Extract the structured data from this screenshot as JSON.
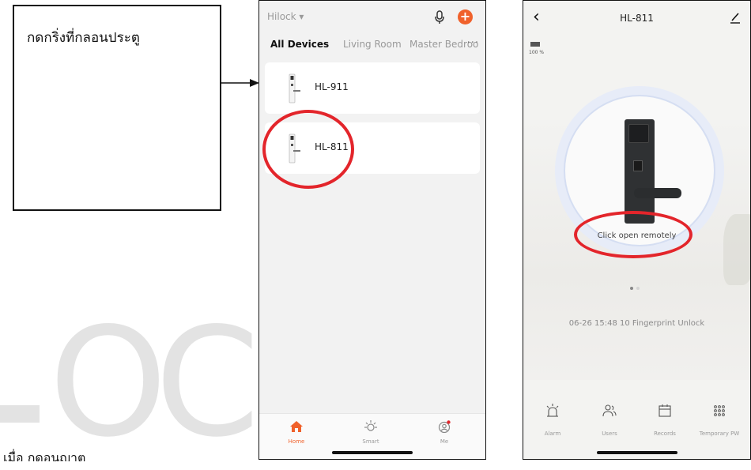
{
  "note": {
    "text": "กดกริ่งที่กลอนประตู"
  },
  "watermark": {
    "chars": [
      "O",
      "C"
    ]
  },
  "bottom_caption": "เมื่อ กดอนุญาต",
  "device_list_screen": {
    "home_name": "Hilock ▾",
    "tabs": [
      "All Devices",
      "Living Room",
      "Master Bedroo"
    ],
    "more": "···",
    "devices": [
      {
        "name": "HL-911"
      },
      {
        "name": "HL-811"
      }
    ],
    "tabbar": [
      {
        "label": "Home",
        "icon": "home-icon",
        "active": true
      },
      {
        "label": "Smart",
        "icon": "sun-icon",
        "active": false
      },
      {
        "label": "Me",
        "icon": "profile-icon",
        "active": false
      }
    ],
    "accent_color": "#f0612b",
    "highlight_color": "#e3252b"
  },
  "lock_detail_screen": {
    "title": "HL-811",
    "battery": "100 %",
    "remote_open_label": "Click open remotely",
    "latest_record": "06-26 15:48  10 Fingerprint Unlock",
    "actions": [
      {
        "label": "Alarm",
        "icon": "alarm-icon"
      },
      {
        "label": "Users",
        "icon": "users-icon"
      },
      {
        "label": "Records",
        "icon": "calendar-icon"
      },
      {
        "label": "Temporary PW",
        "icon": "keypad-icon"
      }
    ]
  }
}
